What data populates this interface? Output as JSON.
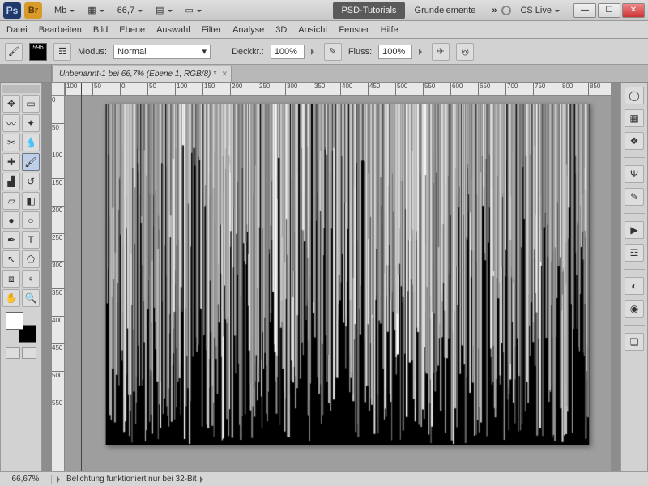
{
  "title": {
    "ps": "Ps",
    "br": "Br",
    "mb_label": "Mb",
    "zoom": "66,7",
    "tab_left": "PSD-Tutorials",
    "tab_right": "Grundelemente",
    "cslive": "CS Live"
  },
  "menu": [
    "Datei",
    "Bearbeiten",
    "Bild",
    "Ebene",
    "Auswahl",
    "Filter",
    "Analyse",
    "3D",
    "Ansicht",
    "Fenster",
    "Hilfe"
  ],
  "options": {
    "swatch_label": "596",
    "modus_label": "Modus:",
    "modus_value": "Normal",
    "opacity_label": "Deckkr.:",
    "opacity_value": "100%",
    "flow_label": "Fluss:",
    "flow_value": "100%"
  },
  "doc_tab": "Unbenannt-1 bei 66,7% (Ebene 1, RGB/8) *",
  "ruler_h": [
    "100",
    "50",
    "0",
    "50",
    "100",
    "150",
    "200",
    "250",
    "300",
    "350",
    "400",
    "450",
    "500",
    "550",
    "600",
    "650",
    "700",
    "750",
    "800",
    "850"
  ],
  "ruler_v": [
    "0",
    "50",
    "100",
    "150",
    "200",
    "250",
    "300",
    "350",
    "400",
    "450",
    "500",
    "550"
  ],
  "status": {
    "zoom": "66,67%",
    "msg": "Belichtung funktioniert nur bei 32-Bit"
  }
}
